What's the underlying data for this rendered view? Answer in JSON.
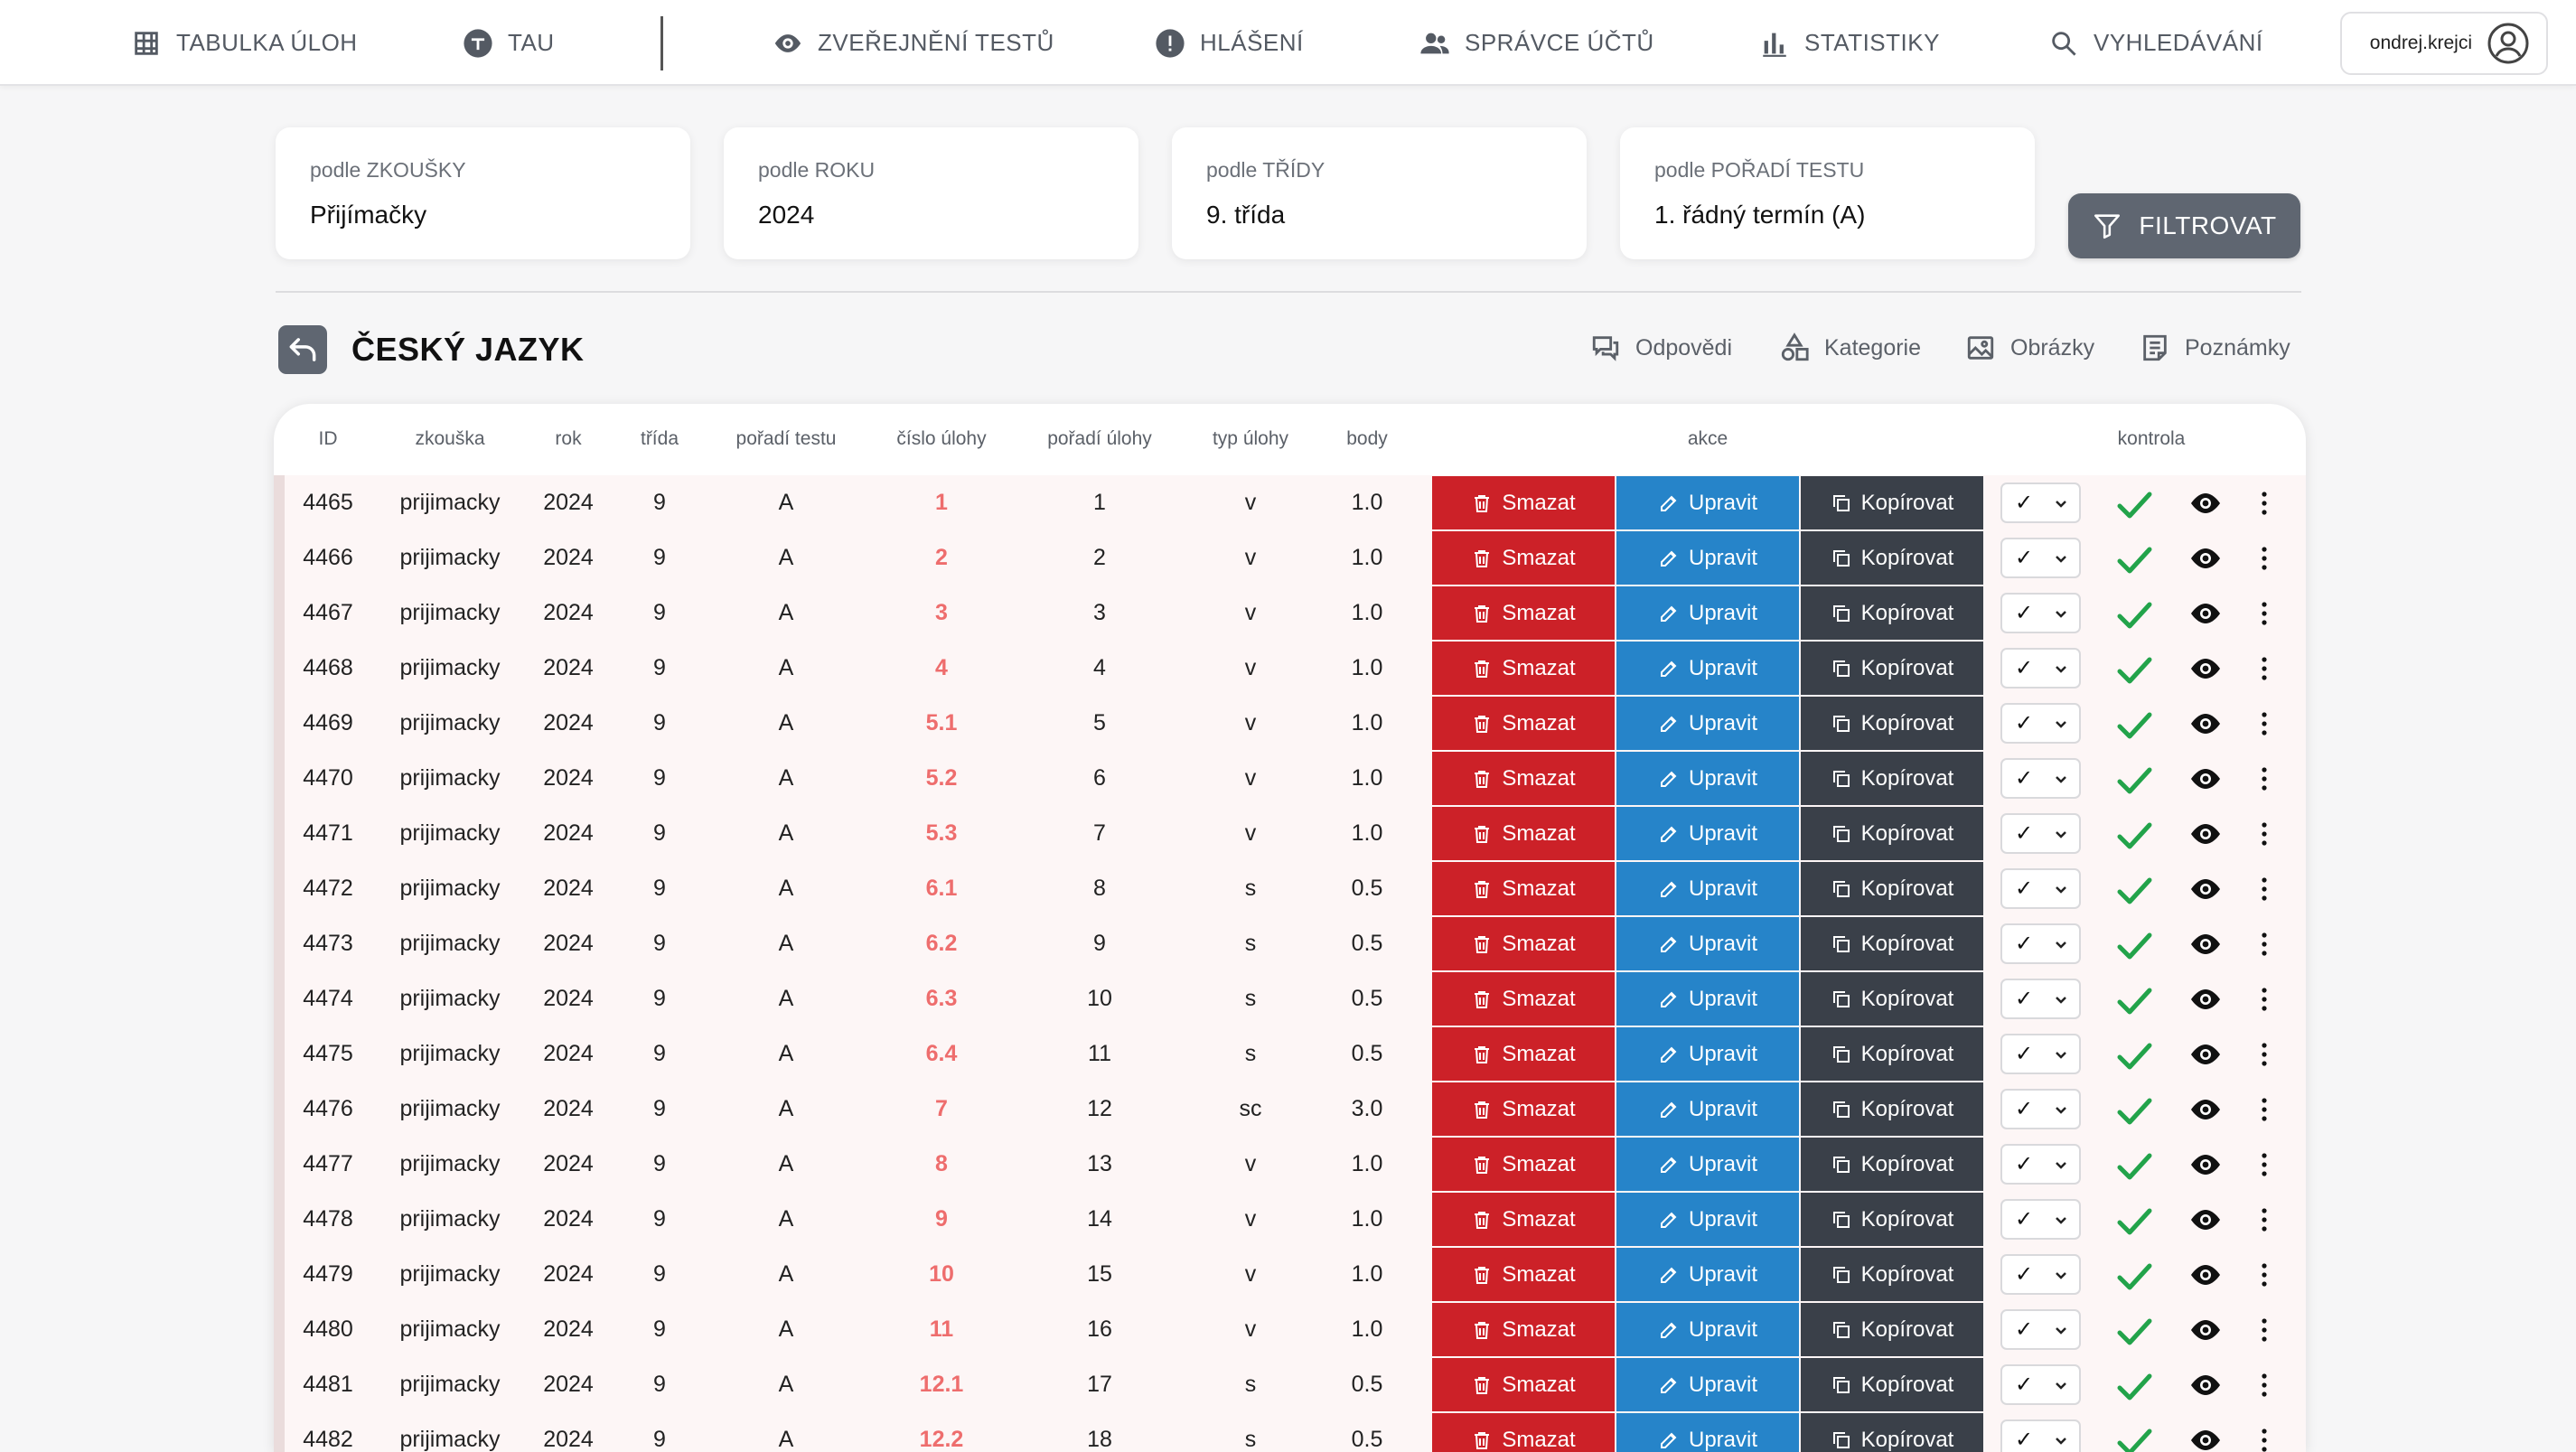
{
  "nav": {
    "items": [
      {
        "label": "TABULKA ÚLOH",
        "icon": "table-icon"
      },
      {
        "label": "TAU",
        "icon": "tau-icon"
      },
      {
        "label": "ZVEŘEJNĚNÍ TESTŮ",
        "icon": "eye-icon"
      },
      {
        "label": "HLÁŠENÍ",
        "icon": "alert-icon"
      },
      {
        "label": "SPRÁVCE ÚČTŮ",
        "icon": "users-icon"
      },
      {
        "label": "STATISTIKY",
        "icon": "bar-chart-icon"
      },
      {
        "label": "VYHLEDÁVÁNÍ",
        "icon": "search-icon"
      }
    ],
    "username": "ondrej.krejci"
  },
  "filters": [
    {
      "label": "podle ZKOUŠKY",
      "value": "Přijímačky"
    },
    {
      "label": "podle ROKU",
      "value": "2024"
    },
    {
      "label": "podle TŘÍDY",
      "value": "9. třída"
    },
    {
      "label": "podle POŘADÍ TESTU",
      "value": "1. řádný termín (A)"
    }
  ],
  "filter_button": "FILTROVAT",
  "section": {
    "title": "ČESKÝ JAZYK",
    "tools": [
      {
        "label": "Odpovědi",
        "icon": "chat-icon"
      },
      {
        "label": "Kategorie",
        "icon": "shapes-icon"
      },
      {
        "label": "Obrázky",
        "icon": "image-icon"
      },
      {
        "label": "Poznámky",
        "icon": "notes-icon"
      }
    ]
  },
  "table": {
    "headers": [
      "ID",
      "zkouška",
      "rok",
      "třída",
      "pořadí testu",
      "číslo úlohy",
      "pořadí úlohy",
      "typ úlohy",
      "body",
      "akce",
      "kontrola"
    ],
    "actions": {
      "delete": "Smazat",
      "edit": "Upravit",
      "copy": "Kopírovat"
    },
    "check_value": "✓",
    "rows": [
      {
        "id": "4465",
        "exam": "prijimacky",
        "year": "2024",
        "grade": "9",
        "test": "A",
        "num": "1",
        "order": "1",
        "type": "v",
        "points": "1.0"
      },
      {
        "id": "4466",
        "exam": "prijimacky",
        "year": "2024",
        "grade": "9",
        "test": "A",
        "num": "2",
        "order": "2",
        "type": "v",
        "points": "1.0"
      },
      {
        "id": "4467",
        "exam": "prijimacky",
        "year": "2024",
        "grade": "9",
        "test": "A",
        "num": "3",
        "order": "3",
        "type": "v",
        "points": "1.0"
      },
      {
        "id": "4468",
        "exam": "prijimacky",
        "year": "2024",
        "grade": "9",
        "test": "A",
        "num": "4",
        "order": "4",
        "type": "v",
        "points": "1.0"
      },
      {
        "id": "4469",
        "exam": "prijimacky",
        "year": "2024",
        "grade": "9",
        "test": "A",
        "num": "5.1",
        "order": "5",
        "type": "v",
        "points": "1.0"
      },
      {
        "id": "4470",
        "exam": "prijimacky",
        "year": "2024",
        "grade": "9",
        "test": "A",
        "num": "5.2",
        "order": "6",
        "type": "v",
        "points": "1.0"
      },
      {
        "id": "4471",
        "exam": "prijimacky",
        "year": "2024",
        "grade": "9",
        "test": "A",
        "num": "5.3",
        "order": "7",
        "type": "v",
        "points": "1.0"
      },
      {
        "id": "4472",
        "exam": "prijimacky",
        "year": "2024",
        "grade": "9",
        "test": "A",
        "num": "6.1",
        "order": "8",
        "type": "s",
        "points": "0.5"
      },
      {
        "id": "4473",
        "exam": "prijimacky",
        "year": "2024",
        "grade": "9",
        "test": "A",
        "num": "6.2",
        "order": "9",
        "type": "s",
        "points": "0.5"
      },
      {
        "id": "4474",
        "exam": "prijimacky",
        "year": "2024",
        "grade": "9",
        "test": "A",
        "num": "6.3",
        "order": "10",
        "type": "s",
        "points": "0.5"
      },
      {
        "id": "4475",
        "exam": "prijimacky",
        "year": "2024",
        "grade": "9",
        "test": "A",
        "num": "6.4",
        "order": "11",
        "type": "s",
        "points": "0.5"
      },
      {
        "id": "4476",
        "exam": "prijimacky",
        "year": "2024",
        "grade": "9",
        "test": "A",
        "num": "7",
        "order": "12",
        "type": "sc",
        "points": "3.0"
      },
      {
        "id": "4477",
        "exam": "prijimacky",
        "year": "2024",
        "grade": "9",
        "test": "A",
        "num": "8",
        "order": "13",
        "type": "v",
        "points": "1.0"
      },
      {
        "id": "4478",
        "exam": "prijimacky",
        "year": "2024",
        "grade": "9",
        "test": "A",
        "num": "9",
        "order": "14",
        "type": "v",
        "points": "1.0"
      },
      {
        "id": "4479",
        "exam": "prijimacky",
        "year": "2024",
        "grade": "9",
        "test": "A",
        "num": "10",
        "order": "15",
        "type": "v",
        "points": "1.0"
      },
      {
        "id": "4480",
        "exam": "prijimacky",
        "year": "2024",
        "grade": "9",
        "test": "A",
        "num": "11",
        "order": "16",
        "type": "v",
        "points": "1.0"
      },
      {
        "id": "4481",
        "exam": "prijimacky",
        "year": "2024",
        "grade": "9",
        "test": "A",
        "num": "12.1",
        "order": "17",
        "type": "s",
        "points": "0.5"
      },
      {
        "id": "4482",
        "exam": "prijimacky",
        "year": "2024",
        "grade": "9",
        "test": "A",
        "num": "12.2",
        "order": "18",
        "type": "s",
        "points": "0.5"
      }
    ]
  }
}
